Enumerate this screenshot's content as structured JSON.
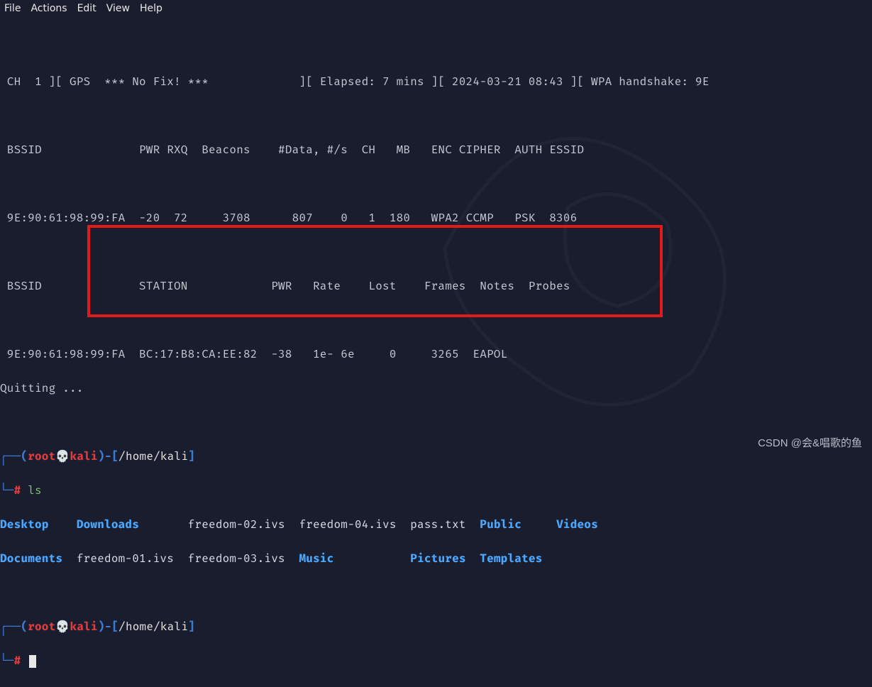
{
  "menubar": {
    "file": "File",
    "actions": "Actions",
    "edit": "Edit",
    "view": "View",
    "help": "Help"
  },
  "airodump": {
    "status_line": " CH  1 ][ GPS  *** No Fix! ***             ][ Elapsed: 7 mins ][ 2024-03-21 08:43 ][ WPA handshake: 9E",
    "ap_header": " BSSID              PWR RXQ  Beacons    #Data, #/s  CH   MB   ENC CIPHER  AUTH ESSID",
    "ap_row": " 9E:90:61:98:99:FA  -20  72     3708      807    0   1  180   WPA2 CCMP   PSK  8306",
    "sta_header": " BSSID              STATION            PWR   Rate    Lost    Frames  Notes  Probes",
    "sta_row": " 9E:90:61:98:99:FA  BC:17:B8:CA:EE:82  -38   1e- 6e     0     3265  EAPOL",
    "quitting": "Quitting ..."
  },
  "prompt1": {
    "dash_l": "┌──(",
    "user": "root",
    "skull": "💀",
    "host": "kali",
    "dash_r": ")-[",
    "path": "/home/kali",
    "close": "]",
    "l2": "└─",
    "hash": "#",
    "cmd": "ls"
  },
  "ls": {
    "col1a": "Desktop",
    "col2a": "Downloads",
    "col3a": "freedom-02.ivs",
    "col4a": "freedom-04.ivs",
    "col5a": "pass.txt",
    "col6a": "Public",
    "col7a": "Videos",
    "col1b": "Documents",
    "col2b": "freedom-01.ivs",
    "col3b": "freedom-03.ivs",
    "col4b": "Music",
    "col5b": "Pictures",
    "col6b": "Templates"
  },
  "prompt2": {
    "dash_l": "┌──(",
    "user": "root",
    "skull": "💀",
    "host": "kali",
    "dash_r": ")-[",
    "path": "/home/kali",
    "close": "]",
    "l2": "└─",
    "hash": "#"
  },
  "watermark": "CSDN @会&唱歌的鱼"
}
